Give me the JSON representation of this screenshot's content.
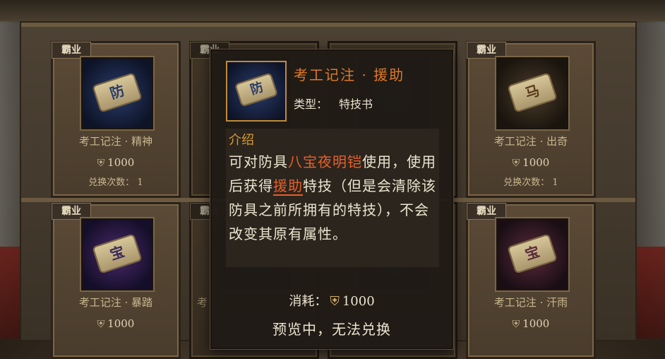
{
  "cards": [
    {
      "tag": "霸业",
      "icon": "scroll-fang-icon",
      "char": "防",
      "name": "考工记注 · 精神",
      "cost": "1000",
      "count": "兑换次数： 1"
    },
    {
      "tag": "霸业",
      "icon": "scroll-icon",
      "char": "",
      "name": "",
      "cost": "",
      "count": ""
    },
    {
      "tag": "",
      "icon": "scroll-icon",
      "char": "",
      "name": "",
      "cost": "",
      "count": ""
    },
    {
      "tag": "霸业",
      "icon": "scroll-ma-icon",
      "char": "马",
      "name": "考工记注 · 出奇",
      "cost": "1000",
      "count": "兑换次数： 1"
    },
    {
      "tag": "霸业",
      "icon": "scroll-bao-icon",
      "char": "宝",
      "name": "考工记注 · 暴踏",
      "cost": "1000",
      "count": ""
    },
    {
      "tag": "霸业",
      "icon": "scroll-icon",
      "char": "",
      "name": "考",
      "cost": "",
      "count": ""
    },
    {
      "tag": "",
      "icon": "scroll-icon",
      "char": "",
      "name": "",
      "cost": "",
      "count": ""
    },
    {
      "tag": "霸业",
      "icon": "scroll-bao-icon",
      "char": "宝",
      "name": "考工记注 · 汗雨",
      "cost": "1000",
      "count": ""
    }
  ],
  "tooltip": {
    "icon": "scroll-fang-icon",
    "icon_char": "防",
    "title": "考工记注 · 援助",
    "type_label": "类型：",
    "type_value": "特技书",
    "intro_label": "介绍",
    "desc_part1": "可对防具",
    "desc_hl1": "八宝夜明铠",
    "desc_part2": "使用，使用后获得",
    "desc_hl2": "援助",
    "desc_part3": "特技（但是会清除该防具之前所拥有的特技），不会改变其原有属性。",
    "cost_label": "消耗：",
    "cost_value": "1000",
    "status": "预览中，无法兑换"
  },
  "colors": {
    "title": "#e07a2a",
    "highlight": "#e8602a",
    "intro": "#d89a3a"
  }
}
